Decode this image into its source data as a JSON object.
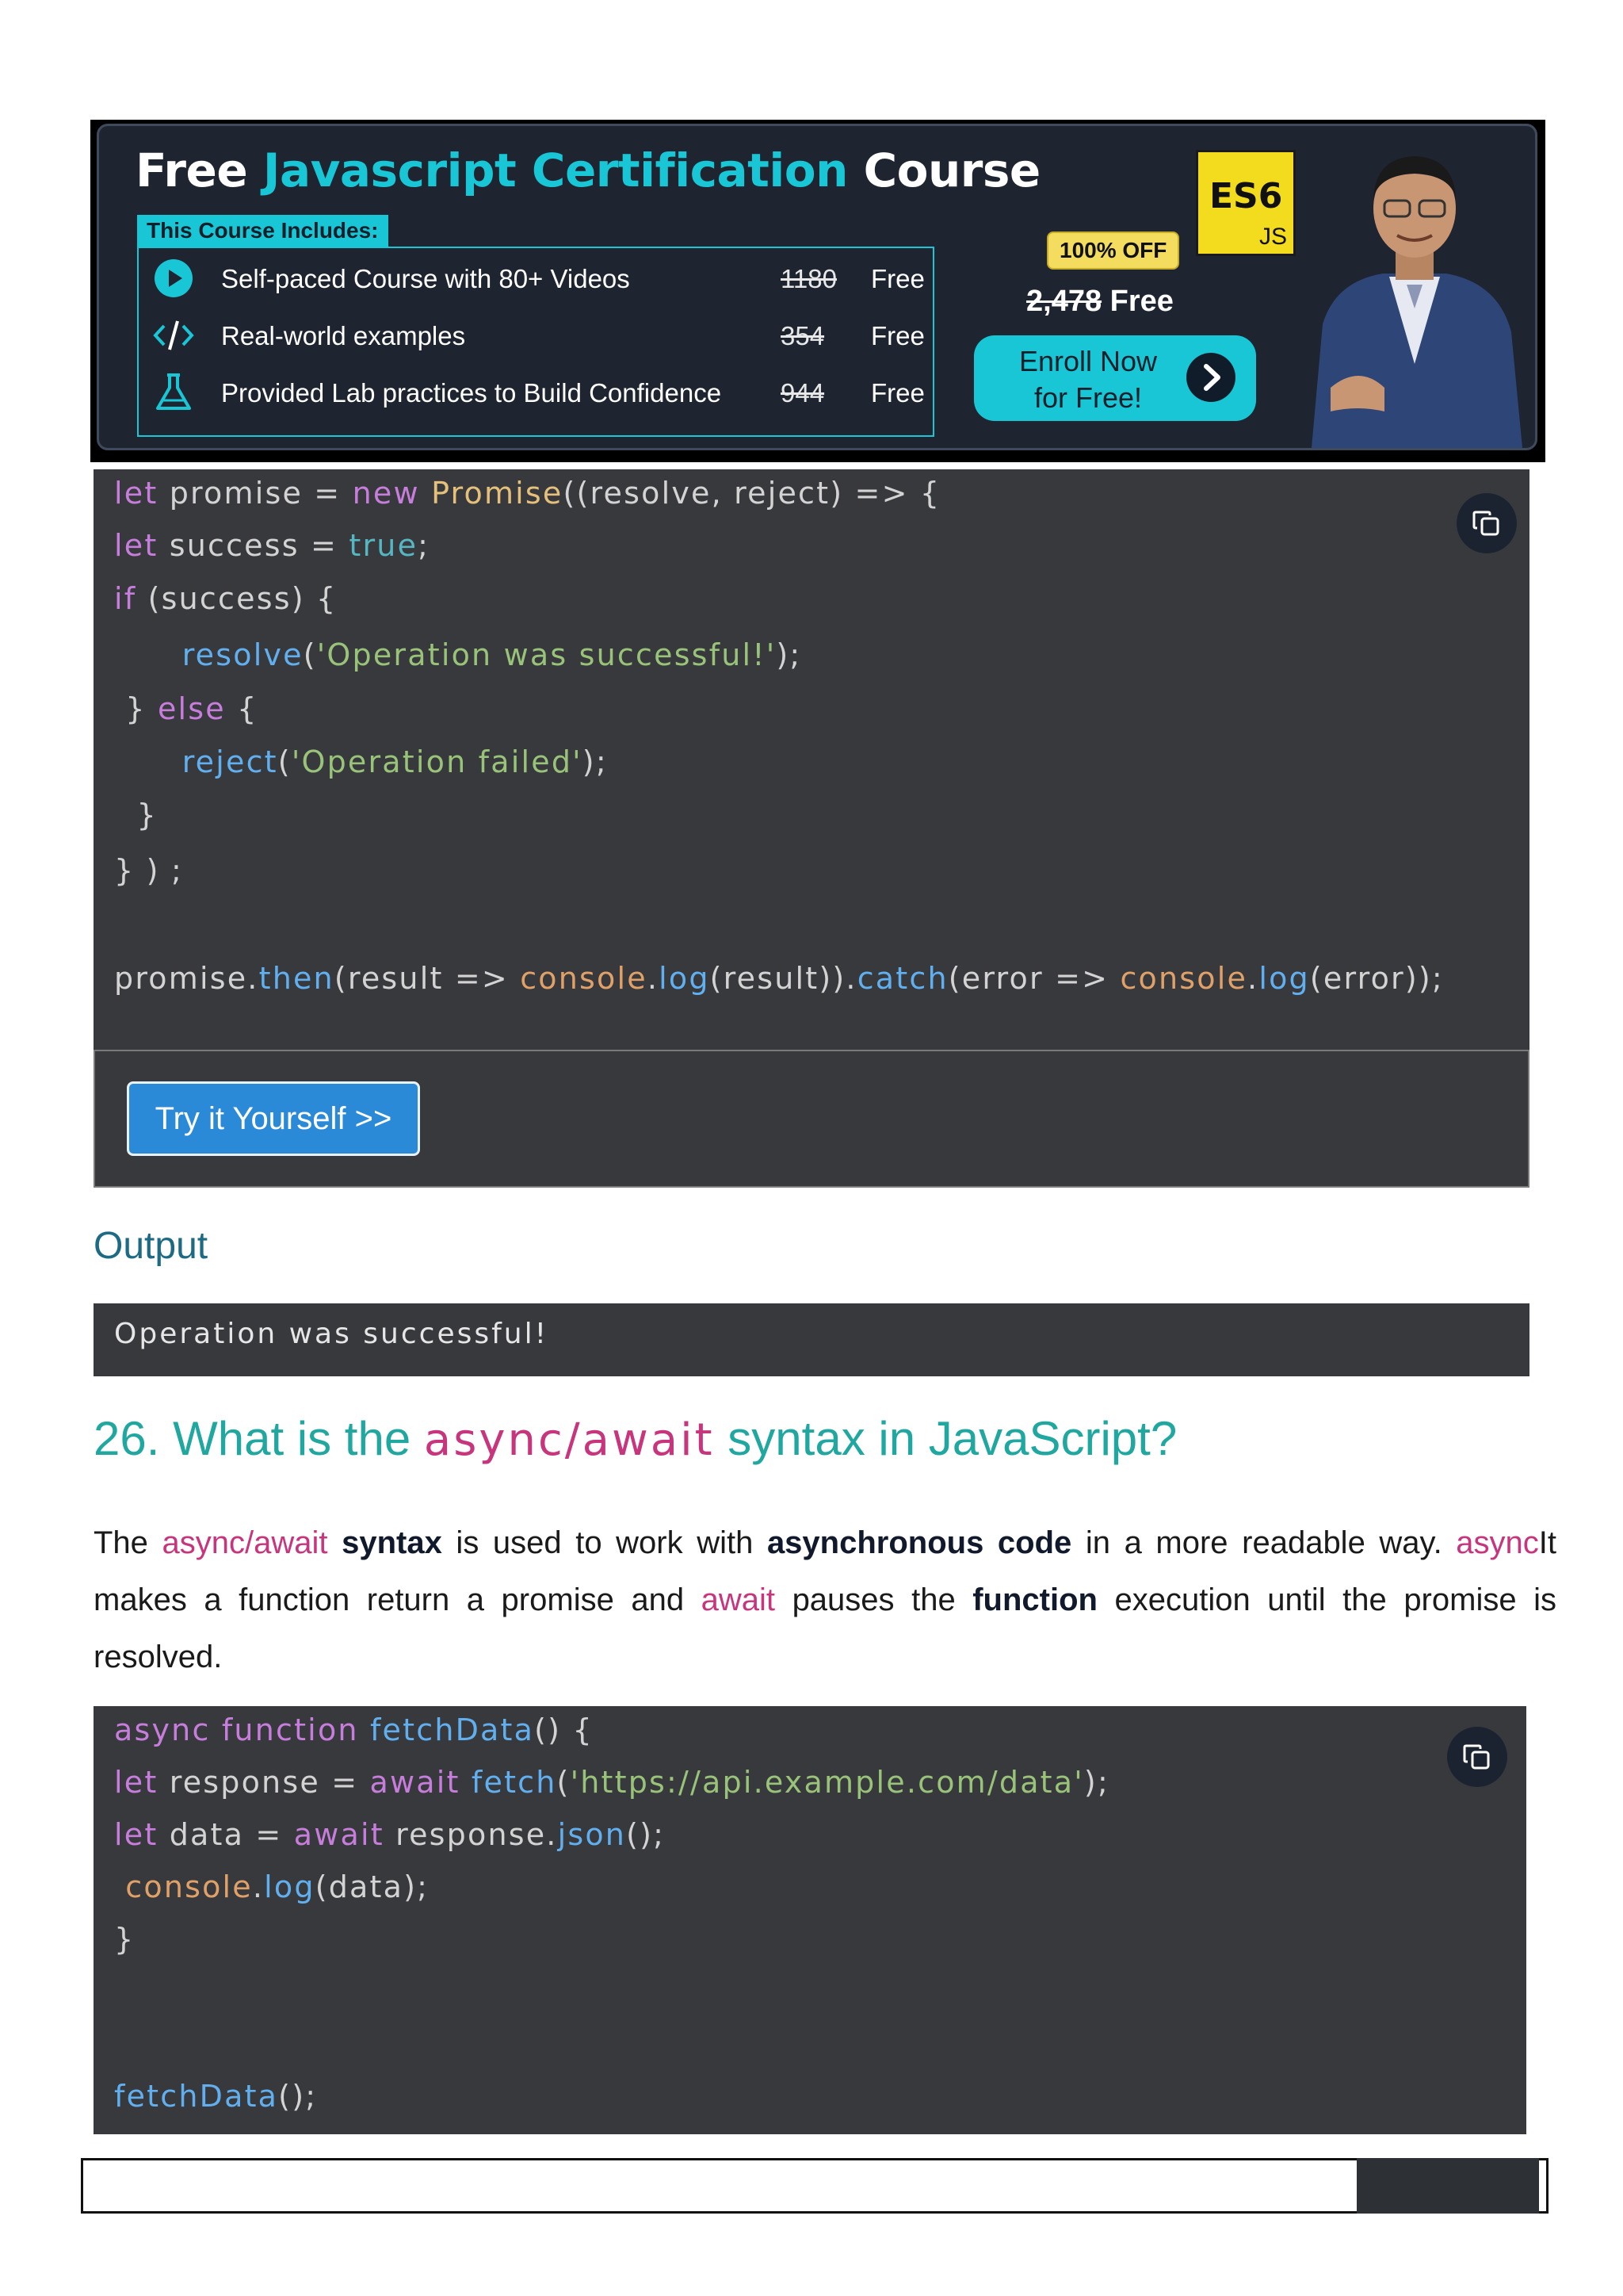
{
  "banner": {
    "title_prefix": "Free ",
    "title_accent": "Javascript Certification",
    "title_suffix": " Course",
    "includes_label": "This Course Includes:",
    "rows": [
      {
        "icon": "play-icon",
        "text": "Self-paced Course with 80+ Videos",
        "old_price": "1180",
        "free": "Free"
      },
      {
        "icon": "code-icon",
        "text": "Real-world examples",
        "old_price": "354",
        "free": "Free"
      },
      {
        "icon": "flask-icon",
        "text": "Provided Lab practices to Build Confidence",
        "old_price": "944",
        "free": "Free"
      }
    ],
    "badge": "100% OFF",
    "price_old": "2,478",
    "price_free": " Free",
    "enroll_label_1": "Enroll Now",
    "enroll_label_2": "for Free!",
    "logo_es6": "ES6",
    "logo_js": "JS",
    "accent_color": "#19c6d6"
  },
  "code1": {
    "lines": [
      [
        {
          "t": "let",
          "c": "kw"
        },
        {
          "t": " promise = ",
          "c": ""
        },
        {
          "t": "new",
          "c": "kw"
        },
        {
          "t": " ",
          "c": ""
        },
        {
          "t": "Promise",
          "c": "cls"
        },
        {
          "t": "((resolve, reject) => {",
          "c": ""
        }
      ],
      [
        {
          "t": "let",
          "c": "kw"
        },
        {
          "t": " success = ",
          "c": ""
        },
        {
          "t": "true",
          "c": "bool"
        },
        {
          "t": ";",
          "c": ""
        }
      ],
      [
        {
          "t": "if",
          "c": "kw"
        },
        {
          "t": " (success) {",
          "c": ""
        }
      ],
      [
        {
          "t": "      ",
          "c": ""
        },
        {
          "t": "resolve",
          "c": "fn"
        },
        {
          "t": "(",
          "c": ""
        },
        {
          "t": "'Operation was successful!'",
          "c": "str"
        },
        {
          "t": ");",
          "c": ""
        }
      ],
      [
        {
          "t": " } ",
          "c": ""
        },
        {
          "t": "else",
          "c": "kw"
        },
        {
          "t": " {",
          "c": ""
        }
      ],
      [
        {
          "t": "      ",
          "c": ""
        },
        {
          "t": "reject",
          "c": "fn"
        },
        {
          "t": "(",
          "c": ""
        },
        {
          "t": "'Operation failed'",
          "c": "str"
        },
        {
          "t": ");",
          "c": ""
        }
      ],
      [
        {
          "t": "  }",
          "c": ""
        }
      ],
      [
        {
          "t": "} ) ;",
          "c": ""
        }
      ],
      [],
      [
        {
          "t": "promise.",
          "c": ""
        },
        {
          "t": "then",
          "c": "fn"
        },
        {
          "t": "(result => ",
          "c": ""
        },
        {
          "t": "console",
          "c": "con"
        },
        {
          "t": ".",
          "c": ""
        },
        {
          "t": "log",
          "c": "fn"
        },
        {
          "t": "(result)).",
          "c": ""
        },
        {
          "t": "catch",
          "c": "fn"
        },
        {
          "t": "(error => ",
          "c": ""
        },
        {
          "t": "console",
          "c": "con"
        },
        {
          "t": ".",
          "c": ""
        },
        {
          "t": "log",
          "c": "fn"
        },
        {
          "t": "(error));",
          "c": ""
        }
      ]
    ],
    "try_label": "Try it Yourself >>"
  },
  "output": {
    "heading": "Output",
    "text": "Operation was successful!"
  },
  "question": {
    "prefix": "26. What is the ",
    "mono": "async/await",
    "suffix": " syntax in JavaScript?"
  },
  "paragraph": [
    {
      "t": "The ",
      "c": ""
    },
    {
      "t": "async/await",
      "c": "pink"
    },
    {
      "t": " ",
      "c": ""
    },
    {
      "t": "syntax",
      "c": "bold"
    },
    {
      "t": " is used to work with ",
      "c": ""
    },
    {
      "t": "asynchronous code",
      "c": "bold"
    },
    {
      "t": " in a more readable way. ",
      "c": ""
    },
    {
      "t": "async",
      "c": "pink"
    },
    {
      "t": "It makes a function return a promise and ",
      "c": ""
    },
    {
      "t": "await",
      "c": "pink"
    },
    {
      "t": " pauses the ",
      "c": ""
    },
    {
      "t": "function",
      "c": "bold"
    },
    {
      "t": " execution until the promise is resolved.",
      "c": ""
    }
  ],
  "code2": {
    "lines": [
      [
        {
          "t": "async",
          "c": "kw"
        },
        {
          "t": " ",
          "c": ""
        },
        {
          "t": "function",
          "c": "kw"
        },
        {
          "t": " ",
          "c": ""
        },
        {
          "t": "fetchData",
          "c": "fn"
        },
        {
          "t": "() {",
          "c": ""
        }
      ],
      [
        {
          "t": "let",
          "c": "kw"
        },
        {
          "t": " response = ",
          "c": ""
        },
        {
          "t": "await",
          "c": "kw"
        },
        {
          "t": " ",
          "c": ""
        },
        {
          "t": "fetch",
          "c": "fn"
        },
        {
          "t": "(",
          "c": ""
        },
        {
          "t": "'https://api.example.com/data'",
          "c": "str"
        },
        {
          "t": ");",
          "c": ""
        }
      ],
      [
        {
          "t": "let",
          "c": "kw"
        },
        {
          "t": " data = ",
          "c": ""
        },
        {
          "t": "await",
          "c": "kw"
        },
        {
          "t": " response.",
          "c": ""
        },
        {
          "t": "json",
          "c": "fn"
        },
        {
          "t": "();",
          "c": ""
        }
      ],
      [
        {
          "t": " ",
          "c": ""
        },
        {
          "t": "console",
          "c": "con"
        },
        {
          "t": ".",
          "c": ""
        },
        {
          "t": "log",
          "c": "fn"
        },
        {
          "t": "(data);",
          "c": ""
        }
      ],
      [
        {
          "t": "}",
          "c": ""
        }
      ],
      [],
      [],
      [
        {
          "t": "fetchData",
          "c": "fn"
        },
        {
          "t": "();",
          "c": ""
        }
      ]
    ]
  }
}
